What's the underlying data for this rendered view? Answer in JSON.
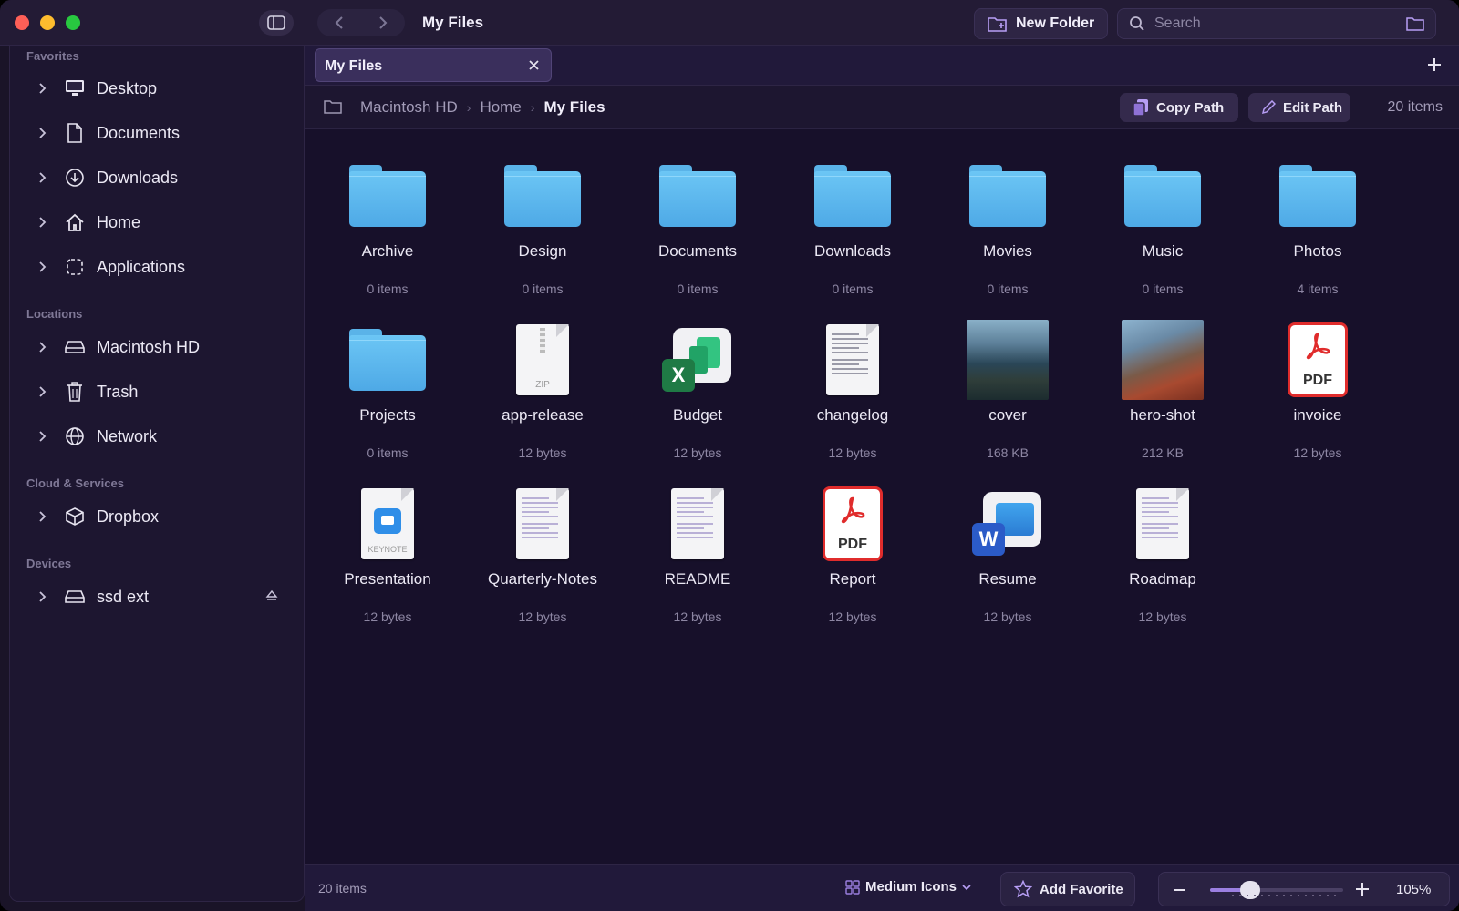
{
  "window": {
    "title": "My Files"
  },
  "toolbar": {
    "new_folder_label": "New Folder",
    "search_placeholder": "Search"
  },
  "sidebar": {
    "sections": [
      {
        "header": "Favorites",
        "items": [
          {
            "label": "Desktop",
            "icon": "desktop-icon"
          },
          {
            "label": "Documents",
            "icon": "document-icon"
          },
          {
            "label": "Downloads",
            "icon": "download-icon"
          },
          {
            "label": "Home",
            "icon": "home-icon"
          },
          {
            "label": "Applications",
            "icon": "applications-icon"
          }
        ]
      },
      {
        "header": "Locations",
        "items": [
          {
            "label": "Macintosh HD",
            "icon": "drive-icon"
          },
          {
            "label": "Trash",
            "icon": "trash-icon"
          },
          {
            "label": "Network",
            "icon": "globe-icon"
          }
        ]
      },
      {
        "header": "Cloud & Services",
        "items": [
          {
            "label": "Dropbox",
            "icon": "dropbox-icon"
          }
        ]
      },
      {
        "header": "Devices",
        "items": [
          {
            "label": "ssd ext",
            "icon": "drive-icon"
          }
        ]
      }
    ]
  },
  "tabs": [
    {
      "label": "My Files"
    }
  ],
  "pathbar": {
    "crumbs": [
      "Macintosh HD",
      "Home",
      "My Files"
    ],
    "copy_path_label": "Copy Path",
    "edit_path_label": "Edit Path",
    "count": "20 items"
  },
  "files": [
    {
      "name": "Archive",
      "meta": "0 items",
      "kind": "folder"
    },
    {
      "name": "Design",
      "meta": "0 items",
      "kind": "folder"
    },
    {
      "name": "Documents",
      "meta": "0 items",
      "kind": "folder"
    },
    {
      "name": "Downloads",
      "meta": "0 items",
      "kind": "folder"
    },
    {
      "name": "Movies",
      "meta": "0 items",
      "kind": "folder"
    },
    {
      "name": "Music",
      "meta": "0 items",
      "kind": "folder"
    },
    {
      "name": "Photos",
      "meta": "4 items",
      "kind": "folder"
    },
    {
      "name": "Projects",
      "meta": "0 items",
      "kind": "folder"
    },
    {
      "name": "app-release",
      "meta": "12 bytes",
      "kind": "zip",
      "badge": "ZIP"
    },
    {
      "name": "Budget",
      "meta": "12 bytes",
      "kind": "excel",
      "badge": "X"
    },
    {
      "name": "changelog",
      "meta": "12 bytes",
      "kind": "text"
    },
    {
      "name": "cover",
      "meta": "168 KB",
      "kind": "photo-cover"
    },
    {
      "name": "hero-shot",
      "meta": "212 KB",
      "kind": "photo-hero"
    },
    {
      "name": "invoice",
      "meta": "12 bytes",
      "kind": "pdf",
      "badge": "PDF"
    },
    {
      "name": "Presentation",
      "meta": "12 bytes",
      "kind": "keynote",
      "badge": "KEYNOTE"
    },
    {
      "name": "Quarterly-Notes",
      "meta": "12 bytes",
      "kind": "markdown"
    },
    {
      "name": "README",
      "meta": "12 bytes",
      "kind": "markdown"
    },
    {
      "name": "Report",
      "meta": "12 bytes",
      "kind": "pdf",
      "badge": "PDF"
    },
    {
      "name": "Resume",
      "meta": "12 bytes",
      "kind": "word",
      "badge": "W"
    },
    {
      "name": "Roadmap",
      "meta": "12 bytes",
      "kind": "markdown"
    }
  ],
  "bottombar": {
    "status": "20 items",
    "view_mode": "Medium Icons",
    "add_favorite_label": "Add Favorite",
    "zoom_level": "105%",
    "zoom_fraction": 0.3
  },
  "colors": {
    "accent": "#9b7fe0",
    "folder": "#5ab3e8",
    "pdf_red": "#e02c2c",
    "excel_green": "#1f7a45",
    "word_blue": "#2b5bc8",
    "keynote_blue": "#2f8ee8"
  }
}
